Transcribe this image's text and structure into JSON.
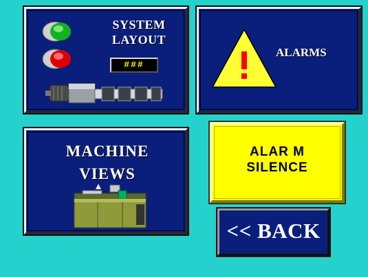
{
  "system_layout": {
    "title": "SYSTEM LAYOUT",
    "display_value": "###",
    "icons": [
      "green-indicator-light-icon",
      "red-indicator-light-icon",
      "motor-conveyor-icon"
    ]
  },
  "alarms": {
    "title": "ALARMS",
    "icon": "warning-triangle-icon"
  },
  "machine_views": {
    "title": "MACHINE VIEWS",
    "icon": "injection-machine-icon"
  },
  "alarm_silence": {
    "title": "ALAR M SILENCE"
  },
  "back": {
    "label": "<< BACK"
  },
  "colors": {
    "background": "#25d1cd",
    "panel": "#0a1f7c",
    "silence": "#ffff00",
    "warning": "#ffff33",
    "alert": "#ff0000",
    "indicator_green": "#1fbf2a",
    "indicator_red": "#e00000"
  }
}
